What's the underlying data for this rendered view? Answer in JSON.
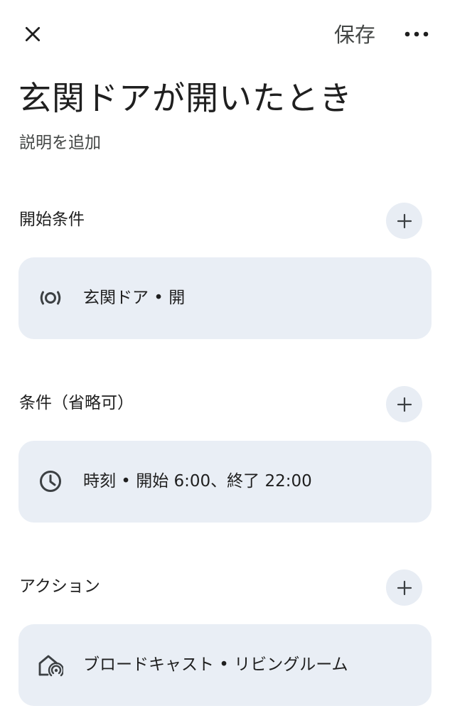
{
  "header": {
    "save_label": "保存"
  },
  "title": "玄関ドアが開いたとき",
  "description_placeholder": "説明を追加",
  "sections": [
    {
      "label": "開始条件",
      "item": {
        "icon": "sensor-icon",
        "text": "玄関ドア • 開"
      }
    },
    {
      "label": "条件（省略可）",
      "item": {
        "icon": "clock-icon",
        "text": "時刻 • 開始 6:00、終了 22:00"
      }
    },
    {
      "label": "アクション",
      "item": {
        "icon": "home-broadcast-icon",
        "text": "ブロードキャスト • リビングルーム"
      }
    }
  ],
  "colors": {
    "card_background": "#e9eef5",
    "add_button_background": "#e8edf4",
    "text_primary": "#1f1f1f",
    "text_secondary": "#444746"
  }
}
